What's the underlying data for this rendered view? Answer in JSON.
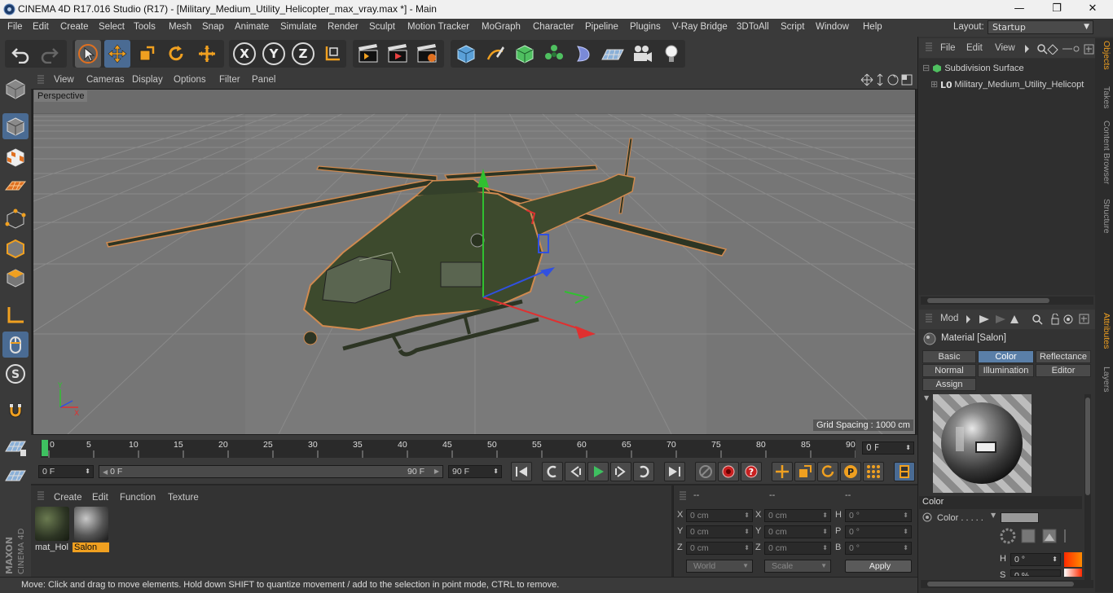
{
  "title_bar": {
    "title": "CINEMA 4D R17.016 Studio (R17) - [Military_Medium_Utility_Helicopter_max_vray.max *] - Main",
    "minimize": "—",
    "restore": "❐",
    "close": "✕"
  },
  "menu": {
    "items": [
      "File",
      "Edit",
      "Create",
      "Select",
      "Tools",
      "Mesh",
      "Snap",
      "Animate",
      "Simulate",
      "Render",
      "Sculpt",
      "Motion Tracker",
      "MoGraph",
      "Character",
      "Pipeline",
      "Plugins",
      "V-Ray Bridge",
      "3DToAll",
      "Script",
      "Window",
      "Help"
    ],
    "layout_label": "Layout:",
    "layout_value": "Startup"
  },
  "toolbar": {
    "axis_x": "X",
    "axis_y": "Y",
    "axis_z": "Z"
  },
  "viewport": {
    "menu": [
      "View",
      "Cameras",
      "Display",
      "Options",
      "Filter",
      "Panel"
    ],
    "label": "Perspective",
    "grid_spacing": "Grid Spacing : 1000 cm"
  },
  "timeline": {
    "ticks": [
      "0",
      "5",
      "10",
      "15",
      "20",
      "25",
      "30",
      "35",
      "40",
      "45",
      "50",
      "55",
      "60",
      "65",
      "70",
      "75",
      "80",
      "85",
      "90"
    ],
    "end_field": "0 F"
  },
  "transport": {
    "current_frame": "0 F",
    "range_start": "0 F",
    "range_end_inner": "90 F",
    "range_end": "90 F"
  },
  "material_manager": {
    "menu": [
      "Create",
      "Edit",
      "Function",
      "Texture"
    ],
    "materials": [
      {
        "name": "mat_Hol",
        "selected": false
      },
      {
        "name": "Salon",
        "selected": true
      }
    ]
  },
  "coordinates": {
    "header_a": "--",
    "header_b": "--",
    "header_c": "--",
    "pos": [
      {
        "axis": "X",
        "value": "0 cm"
      },
      {
        "axis": "Y",
        "value": "0 cm"
      },
      {
        "axis": "Z",
        "value": "0 cm"
      }
    ],
    "size": [
      {
        "axis": "X",
        "value": "0 cm"
      },
      {
        "axis": "Y",
        "value": "0 cm"
      },
      {
        "axis": "Z",
        "value": "0 cm"
      }
    ],
    "rot": [
      {
        "axis": "H",
        "value": "0 °"
      },
      {
        "axis": "P",
        "value": "0 °"
      },
      {
        "axis": "B",
        "value": "0 °"
      }
    ],
    "mode_world": "World",
    "mode_scale": "Scale",
    "apply": "Apply"
  },
  "status_bar": {
    "text": "Move: Click and drag to move elements. Hold down SHIFT to quantize movement / add to the selection in point mode, CTRL to remove."
  },
  "object_manager": {
    "menu": [
      "File",
      "Edit",
      "View"
    ],
    "objects": [
      {
        "name": "Subdivision Surface"
      },
      {
        "name": "Military_Medium_Utility_Helicopt"
      }
    ]
  },
  "side_tabs": [
    "Objects",
    "Takes",
    "Content Browser",
    "Structure",
    "Attributes",
    "Layers"
  ],
  "attributes": {
    "mode_label": "Mod",
    "title": "Material [Salon]",
    "tabs": [
      "Basic",
      "Color",
      "Reflectance",
      "Normal",
      "Illumination",
      "Editor",
      "Assign"
    ],
    "active_tab": "Color",
    "section": "Color",
    "color_label": "Color . . . . .",
    "h_label": "H",
    "h_value": "0 °",
    "s_label": "S",
    "s_value": "0 %"
  },
  "colors": {
    "accent": "#5a7fa8",
    "selected_material": "#f0a020",
    "orange_highlight": "#e07020"
  }
}
